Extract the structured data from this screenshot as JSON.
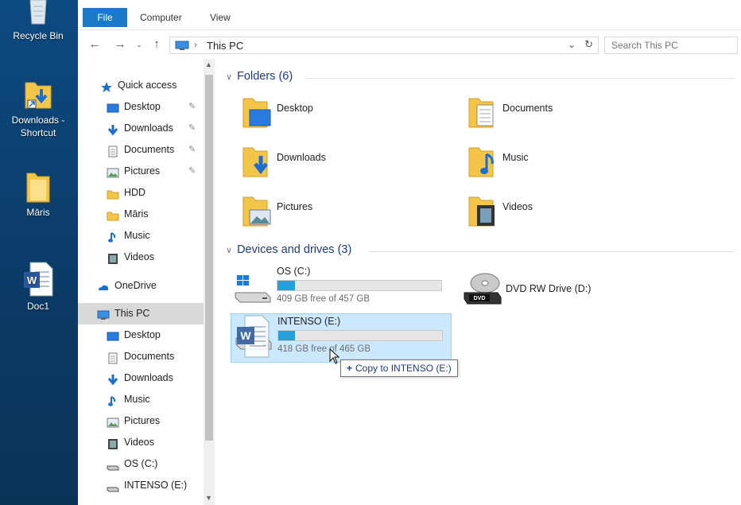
{
  "desktop": {
    "icons": [
      {
        "label": "Recycle Bin"
      },
      {
        "label": "Downloads - Shortcut"
      },
      {
        "label": "Māris"
      },
      {
        "label": "Doc1"
      }
    ]
  },
  "ribbon": {
    "tabs": [
      "File",
      "Computer",
      "View"
    ]
  },
  "address": {
    "path": "This PC",
    "search_placeholder": "Search This PC"
  },
  "nav": {
    "quick_access": "Quick access",
    "quick_items": [
      {
        "label": "Desktop",
        "icon": "desktop-icon",
        "pinned": true
      },
      {
        "label": "Downloads",
        "icon": "download-arrow-icon",
        "pinned": true
      },
      {
        "label": "Documents",
        "icon": "documents-icon",
        "pinned": true
      },
      {
        "label": "Pictures",
        "icon": "pictures-icon",
        "pinned": true
      },
      {
        "label": "HDD",
        "icon": "folder-icon",
        "pinned": false
      },
      {
        "label": "Māris",
        "icon": "folder-icon",
        "pinned": false
      },
      {
        "label": "Music",
        "icon": "music-icon",
        "pinned": false
      },
      {
        "label": "Videos",
        "icon": "videos-icon",
        "pinned": false
      }
    ],
    "onedrive": "OneDrive",
    "this_pc": "This PC",
    "pc_items": [
      {
        "label": "Desktop",
        "icon": "desktop-icon"
      },
      {
        "label": "Documents",
        "icon": "documents-icon"
      },
      {
        "label": "Downloads",
        "icon": "download-arrow-icon"
      },
      {
        "label": "Music",
        "icon": "music-icon"
      },
      {
        "label": "Pictures",
        "icon": "pictures-icon"
      },
      {
        "label": "Videos",
        "icon": "videos-icon"
      },
      {
        "label": "OS (C:)",
        "icon": "drive-icon"
      },
      {
        "label": "INTENSO (E:)",
        "icon": "drive-icon"
      }
    ]
  },
  "content": {
    "folders_header": "Folders (6)",
    "folders": [
      {
        "label": "Desktop"
      },
      {
        "label": "Documents"
      },
      {
        "label": "Downloads"
      },
      {
        "label": "Music"
      },
      {
        "label": "Pictures"
      },
      {
        "label": "Videos"
      }
    ],
    "devices_header": "Devices and drives (3)",
    "drives": [
      {
        "name": "OS (C:)",
        "free_text": "409 GB free of 457 GB",
        "used_fraction": 0.105
      },
      {
        "name": "DVD RW Drive (D:)"
      },
      {
        "name": "INTENSO (E:)",
        "free_text": "418 GB free of 465 GB",
        "used_fraction": 0.101
      }
    ]
  },
  "drag": {
    "tooltip_text": "Copy to INTENSO (E:)",
    "plus": "+"
  },
  "colors": {
    "accent": "#1979ca",
    "bar_fill": "#26a0da",
    "selection": "#cce8ff",
    "desktop_bg": "#0c3f6e"
  }
}
